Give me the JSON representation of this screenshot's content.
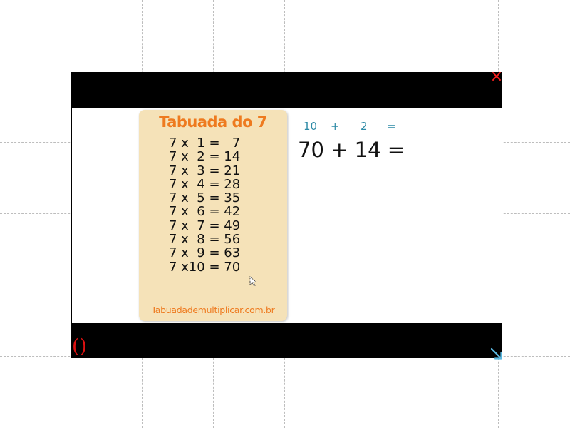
{
  "card": {
    "title": "Tabuada do 7",
    "lines": [
      "7 x  1 =   7",
      "7 x  2 = 14",
      "7 x  3 = 21",
      "7 x  4 = 28",
      "7 x  5 = 35",
      "7 x  6 = 42",
      "7 x  7 = 49",
      "7 x  8 = 56",
      "7 x  9 = 63",
      "7 x10 = 70"
    ],
    "footer": "Tabuadademultiplicar.com.br",
    "background_color": "#f5e2b8",
    "accent_color": "#ee7a1f"
  },
  "small_equation": {
    "a": "10",
    "plus": "+",
    "b": "2",
    "equals": "=",
    "color": "#2d8aa6"
  },
  "big_equation": {
    "text": "70 + 14 ="
  },
  "controls": {
    "close_symbol": "×",
    "paren_symbol": "()",
    "close_color": "#ff2020",
    "resize_color": "#5bb8e0"
  },
  "icons": {
    "close": "close-icon",
    "fullscreen": "paren-icon",
    "resize": "resize-arrow-icon",
    "cursor": "mouse-cursor-icon"
  }
}
